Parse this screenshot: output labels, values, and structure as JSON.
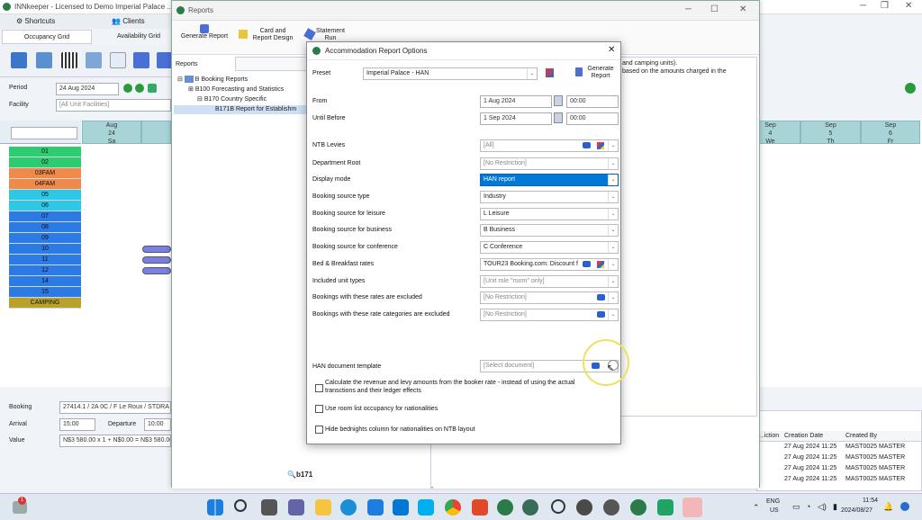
{
  "main": {
    "title": "INNkeeper - Licensed to Demo Imperial Palace ...",
    "tabs": {
      "shortcuts": "Shortcuts",
      "clients": "Clients"
    },
    "subtabs": {
      "occupancy": "Occupancy Grid",
      "availability": "Availability Grid"
    },
    "period_label": "Period",
    "period_value": "24 Aug 2024",
    "facility_label": "Facility",
    "facility_placeholder": "[All Unit Facilities]",
    "grid_dates_left": [
      {
        "m": "Aug",
        "d": "24",
        "w": "Sa"
      }
    ],
    "grid_dates_right": [
      {
        "m": "Sep",
        "d": "4",
        "w": "We"
      },
      {
        "m": "Sep",
        "d": "5",
        "w": "Th"
      },
      {
        "m": "Sep",
        "d": "6",
        "w": "Fr"
      }
    ],
    "rooms": [
      {
        "label": "01",
        "color": "#2ecc71"
      },
      {
        "label": "02",
        "color": "#2ecc71"
      },
      {
        "label": "03FAM",
        "color": "#f08a4b"
      },
      {
        "label": "04FAM",
        "color": "#f08a4b"
      },
      {
        "label": "05",
        "color": "#2ec7e6"
      },
      {
        "label": "06",
        "color": "#2ec7e6"
      },
      {
        "label": "07",
        "color": "#2c7be5"
      },
      {
        "label": "08",
        "color": "#2c7be5"
      },
      {
        "label": "09",
        "color": "#2c7be5"
      },
      {
        "label": "10",
        "color": "#2c7be5"
      },
      {
        "label": "11",
        "color": "#2c7be5"
      },
      {
        "label": "12",
        "color": "#2c7be5"
      },
      {
        "label": "14",
        "color": "#2c7be5"
      },
      {
        "label": "15",
        "color": "#2c7be5"
      },
      {
        "label": "CAMPING",
        "color": "#b8a22c"
      }
    ],
    "booking_label": "Booking",
    "booking_value": "27414.1 / 2A 0C / F Le Roux / STDRA",
    "arrival_label": "Arrival",
    "arrival_value": "15:00",
    "departure_label": "Departure",
    "departure_value": "10:00",
    "value_label": "Value",
    "value_value": "N$3 580.00 x 1 + N$0.00 = N$3 580.00"
  },
  "reports": {
    "title": "Reports",
    "toolbar": {
      "generate": "Generate Report",
      "card_line1": "Card and",
      "card_line2": "Report Design",
      "statement_line1": "Statement",
      "statement_line2": "Run"
    },
    "panel_label": "Reports",
    "tree": [
      "B Booking Reports",
      "B100 Forecasting and Statistics",
      "B170 Country Specific",
      "B171B Report for Establishm"
    ],
    "search_value": "b171",
    "right_text_1": "and camping units).",
    "right_text_2": "based on the amounts charged in the",
    "table_headers": [
      "...iction",
      "Creation Date",
      "Created By"
    ],
    "table_rows": [
      {
        "date": "27 Aug 2024 11:25",
        "by": "MAST0025 MASTER"
      },
      {
        "date": "27 Aug 2024 11:25",
        "by": "MAST0025 MASTER"
      },
      {
        "date": "27 Aug 2024 11:25",
        "by": "MAST0025 MASTER"
      },
      {
        "date": "27 Aug 2024 11:25",
        "by": "MAST0025 MASTER"
      }
    ]
  },
  "dialog": {
    "title": "Accommodation Report Options",
    "preset_label": "Preset",
    "preset_value": "Imperial Palace - HAN",
    "generate_line1": "Generate",
    "generate_line2": "Report",
    "from_label": "From",
    "from_date": "1 Aug 2024",
    "from_time": "00:00",
    "until_label": "Until Before",
    "until_date": "1 Sep 2024",
    "until_time": "00:00",
    "fields": [
      {
        "label": "NTB Levies",
        "value": "[All]",
        "disabled": true,
        "icons": true
      },
      {
        "label": "Department Root",
        "value": "[No Restriction]",
        "disabled": true,
        "icons": false
      },
      {
        "label": "Display mode",
        "value": "HAN report",
        "highlight": true,
        "icons": false
      },
      {
        "label": "Booking source type",
        "value": "Industry",
        "icons": false
      },
      {
        "label": "Booking source for leisure",
        "value": "L Leisure",
        "icons": false
      },
      {
        "label": "Booking source for business",
        "value": "B Business",
        "icons": false
      },
      {
        "label": "Booking source for conference",
        "value": "C Conference",
        "icons": false
      },
      {
        "label": "Bed & Breakfast rates",
        "value": "TOUR23 Booking.com: Discount f",
        "icons": true
      },
      {
        "label": "Included unit types",
        "value": "[Unit role \"room\" only]",
        "disabled": true,
        "icons": false
      },
      {
        "label": "Bookings with these rates are excluded",
        "value": "[No Restriction]",
        "disabled": true,
        "pen": true
      },
      {
        "label": "Bookings with these rate categories are excluded",
        "value": "[No Restriction]",
        "disabled": true,
        "pen": true
      }
    ],
    "template_label": "HAN document template",
    "template_placeholder": "[Select document]",
    "check1_line1": "Calculate the revenue and levy amounts from the booker rate - instead of using the actual",
    "check1_line2": "transctions and their ledger effects",
    "check2": "Use room list occupancy for nationalities",
    "check3": "Hide bednights column for nationalities on NTB layout"
  },
  "taskbar": {
    "lang1": "ENG",
    "lang2": "US",
    "time": "11:54",
    "date": "2024/08/27",
    "badge": "1"
  }
}
